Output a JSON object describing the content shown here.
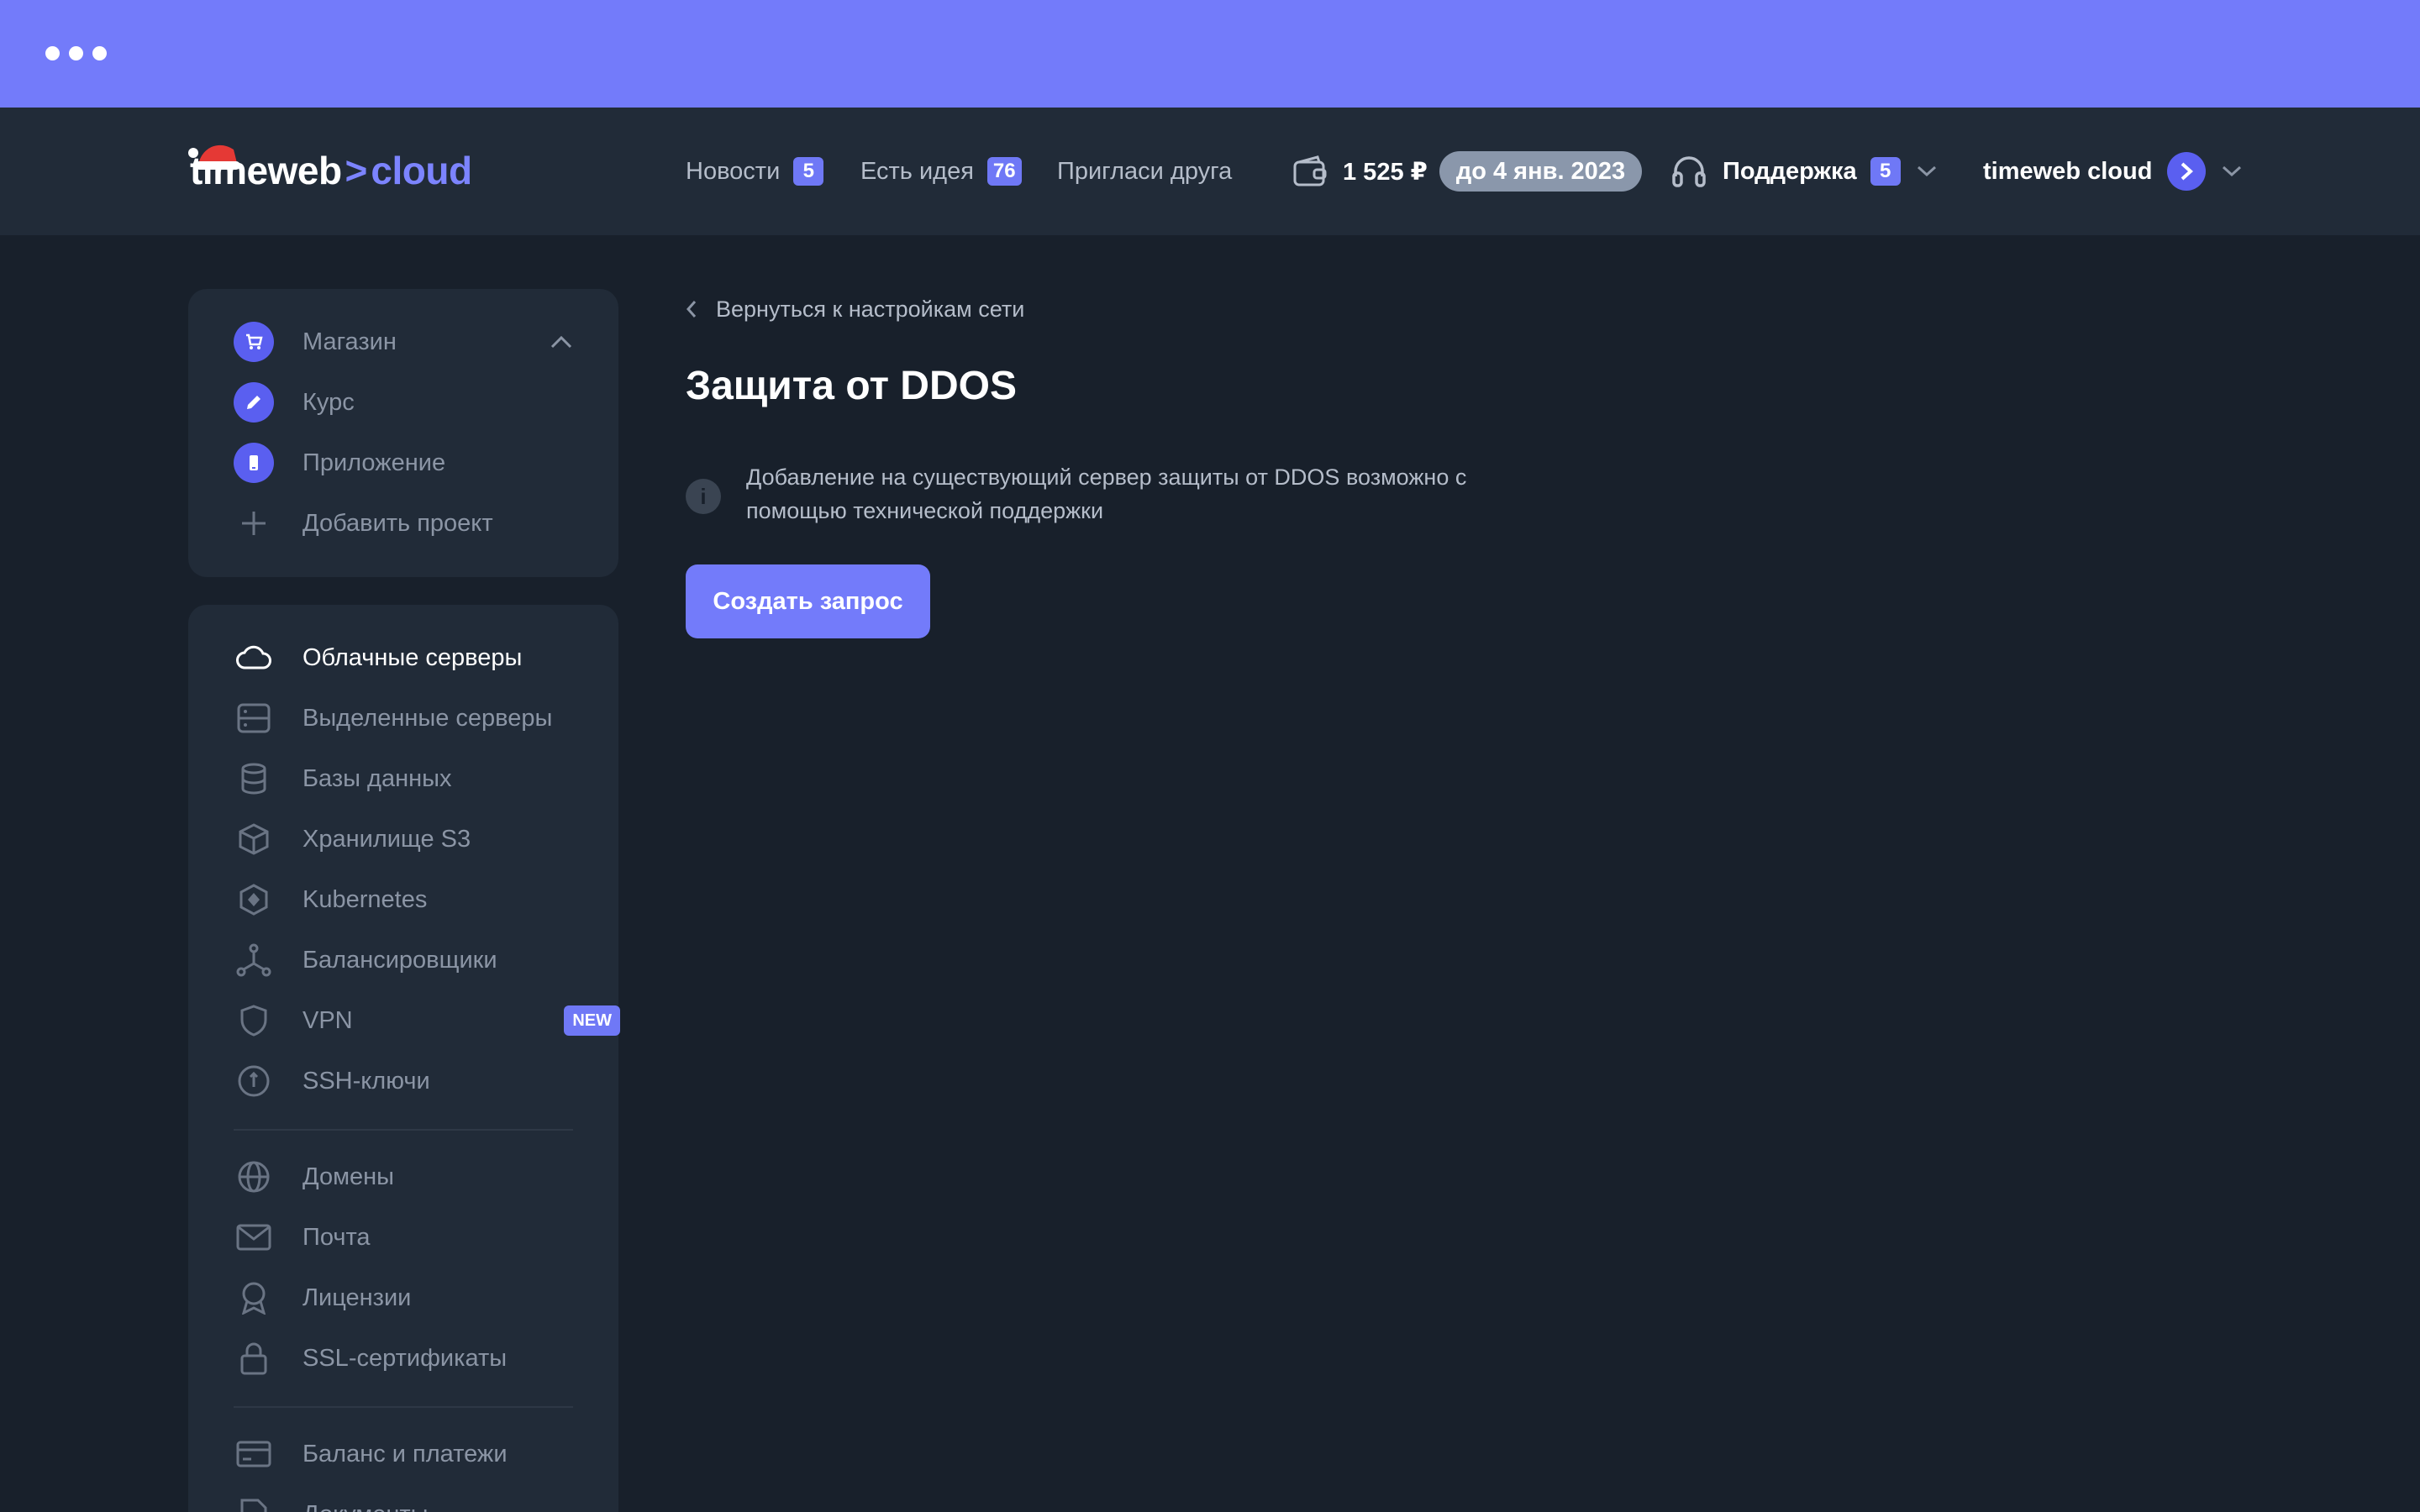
{
  "header": {
    "logo": {
      "word1": "timeweb",
      "arrow": ">",
      "word2": "cloud"
    },
    "nav": [
      {
        "label": "Новости",
        "badge": "5"
      },
      {
        "label": "Есть идея",
        "badge": "76"
      },
      {
        "label": "Пригласи друга"
      }
    ],
    "balance": "1 525 ₽",
    "paid_until": "до 4 янв. 2023",
    "support": {
      "label": "Поддержка",
      "badge": "5"
    },
    "account": {
      "name": "timeweb cloud"
    }
  },
  "sidebar": {
    "projects": [
      {
        "label": "Магазин",
        "icon": "cart-icon"
      },
      {
        "label": "Курс",
        "icon": "pencil-icon"
      },
      {
        "label": "Приложение",
        "icon": "phone-icon"
      },
      {
        "label": "Добавить проект",
        "icon": "plus-icon"
      }
    ],
    "services": [
      {
        "label": "Облачные серверы",
        "icon": "cloud-icon",
        "active": true
      },
      {
        "label": "Выделенные серверы",
        "icon": "server-icon"
      },
      {
        "label": "Базы данных",
        "icon": "database-icon"
      },
      {
        "label": "Хранилище S3",
        "icon": "cube-icon"
      },
      {
        "label": "Kubernetes",
        "icon": "kubernetes-icon"
      },
      {
        "label": "Балансировщики",
        "icon": "balancer-icon"
      },
      {
        "label": "VPN",
        "icon": "shield-icon",
        "badge": "NEW"
      },
      {
        "label": "SSH-ключи",
        "icon": "key-icon"
      }
    ],
    "domains": [
      {
        "label": "Домены",
        "icon": "globe-icon"
      },
      {
        "label": "Почта",
        "icon": "mail-icon"
      },
      {
        "label": "Лицензии",
        "icon": "award-icon"
      },
      {
        "label": "SSL-сертификаты",
        "icon": "lock-icon"
      }
    ],
    "billing": [
      {
        "label": "Баланс и платежи",
        "icon": "card-icon"
      },
      {
        "label": "Документы",
        "icon": "document-icon"
      }
    ]
  },
  "main": {
    "back_label": "Вернуться к настройкам сети",
    "title": "Защита от DDOS",
    "info_icon": "i",
    "info_text": "Добавление на существующий сервер защиты от DDOS возможно с помощью технической поддержки",
    "button_label": "Создать запрос"
  },
  "colors": {
    "accent": "#737bfa",
    "background": "#18202b",
    "panel": "#212b38"
  }
}
